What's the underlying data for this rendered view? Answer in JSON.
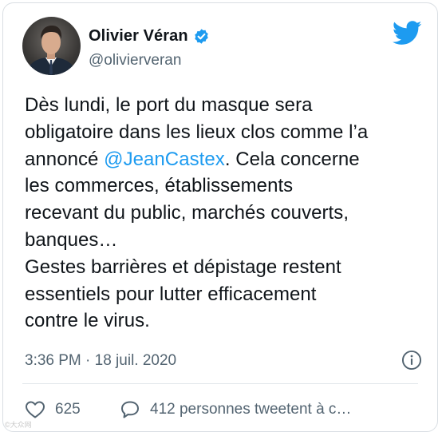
{
  "author": {
    "name": "Olivier Véran",
    "handle": "@olivierveran",
    "verified": true
  },
  "tweet": {
    "text_before_mention": "Dès lundi, le port du masque sera\nobligatoire dans les lieux clos comme l’a\nannoncé ",
    "mention": "@JeanCastex",
    "text_after_mention": ". Cela concerne\nles commerces, établissements\nrecevant du public, marchés couverts,\nbanques…\nGestes barrières et dépistage restent\nessentiels pour lutter efficacement\ncontre le virus."
  },
  "meta": {
    "timestamp": "3:36 PM · 18 juil. 2020"
  },
  "stats": {
    "likes": "625",
    "retweets_text": "412 personnes tweetent à c…"
  },
  "watermark": "©大众网",
  "icons": {
    "logo": "twitter-bird-icon",
    "verified": "verified-badge-icon",
    "info": "info-icon",
    "like": "heart-icon",
    "reply": "speech-bubble-icon"
  },
  "colors": {
    "accent": "#1d9bf0",
    "text": "#0f1419",
    "secondary": "#536471"
  }
}
